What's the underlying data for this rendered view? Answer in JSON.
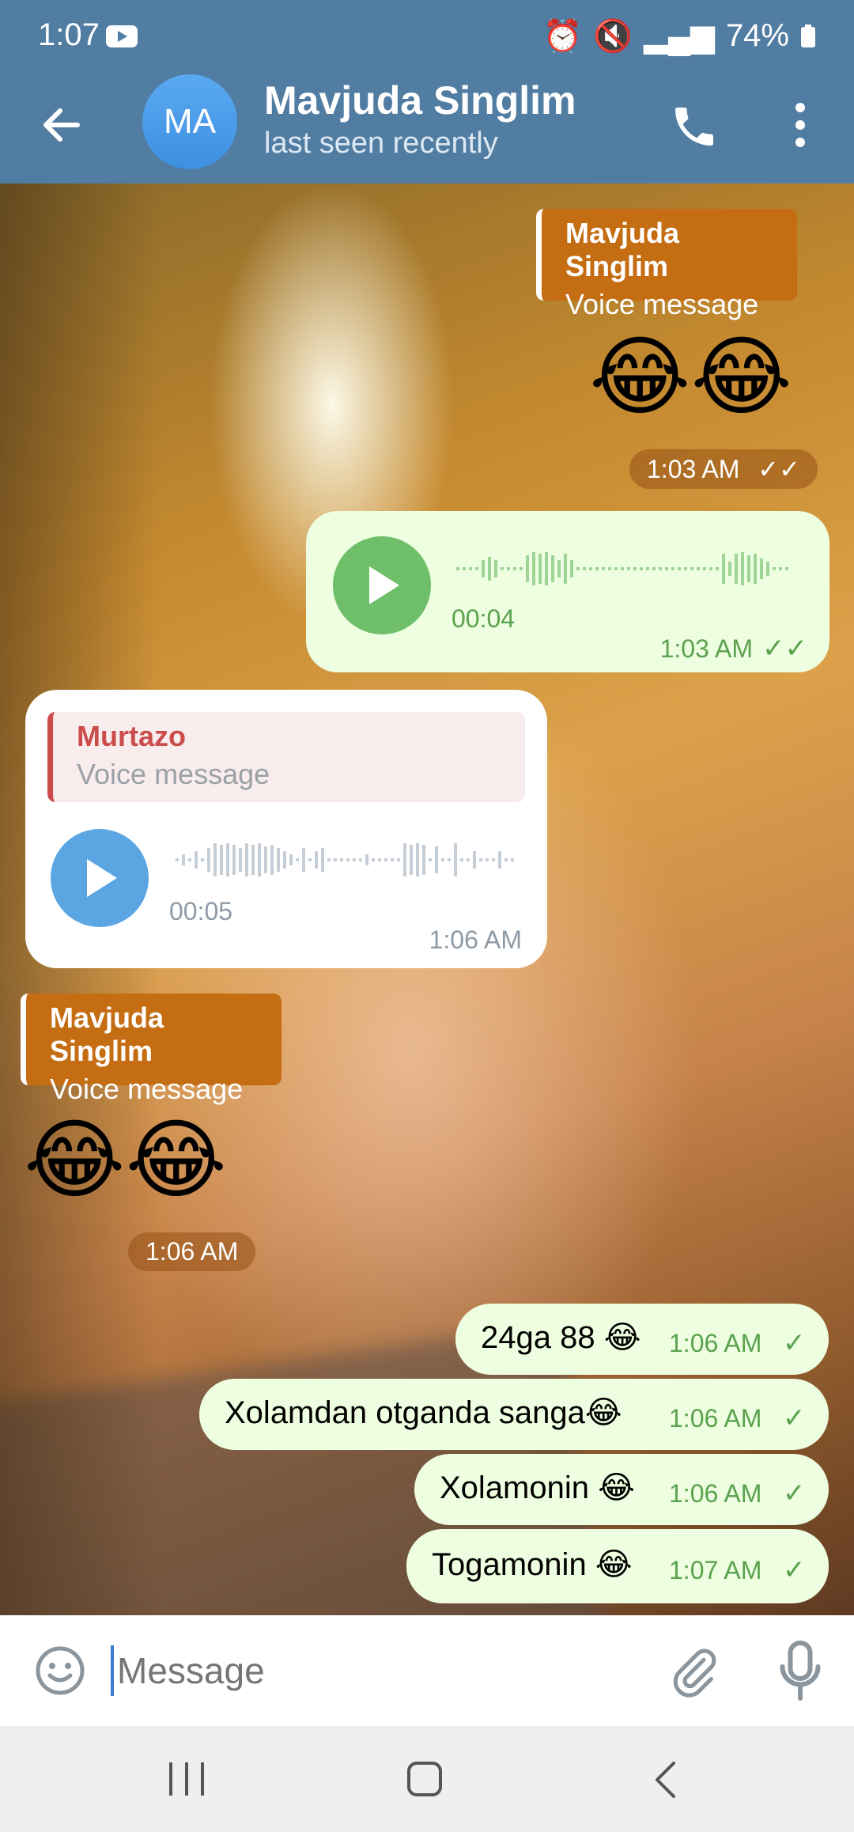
{
  "status_bar": {
    "time": "1:07",
    "battery": "74%"
  },
  "header": {
    "avatar_initials": "MA",
    "contact_name": "Mavjuda Singlim",
    "contact_status": "last seen recently"
  },
  "messages": {
    "m1": {
      "quote_name": "Mavjuda Singlim",
      "quote_text": "Voice message",
      "emoji": "😂😂",
      "time": "1:03 AM"
    },
    "m2": {
      "duration": "00:04",
      "time": "1:03 AM"
    },
    "m3": {
      "quote_name": "Murtazo",
      "quote_text": "Voice message",
      "duration": "00:05",
      "time": "1:06 AM"
    },
    "m4": {
      "quote_name": "Mavjuda Singlim",
      "quote_text": "Voice message",
      "emoji": "😂😂",
      "time": "1:06 AM"
    },
    "m5": {
      "text": "24ga 88 😂",
      "time": "1:06 AM"
    },
    "m6": {
      "text": "Xolamdan otganda sanga😂",
      "time": "1:06 AM"
    },
    "m7": {
      "text": "Xolamonin 😂",
      "time": "1:06 AM"
    },
    "m8": {
      "text": "Togamonin 😂",
      "time": "1:07 AM"
    }
  },
  "input": {
    "placeholder": "Message"
  },
  "colors": {
    "header": "#517da2",
    "outgoing_bubble": "#eefee0",
    "accent_green": "#5aa24e",
    "quote_orange": "#c56d12",
    "in_play": "#5aa5e2",
    "out_play": "#6fbf6a"
  },
  "icons": [
    "back-arrow-icon",
    "phone-icon",
    "more-vert-icon",
    "play-icon",
    "double-check-icon",
    "check-icon",
    "emoji-icon",
    "attach-icon",
    "mic-icon",
    "nav-recents-icon",
    "nav-home-icon",
    "nav-back-icon"
  ]
}
